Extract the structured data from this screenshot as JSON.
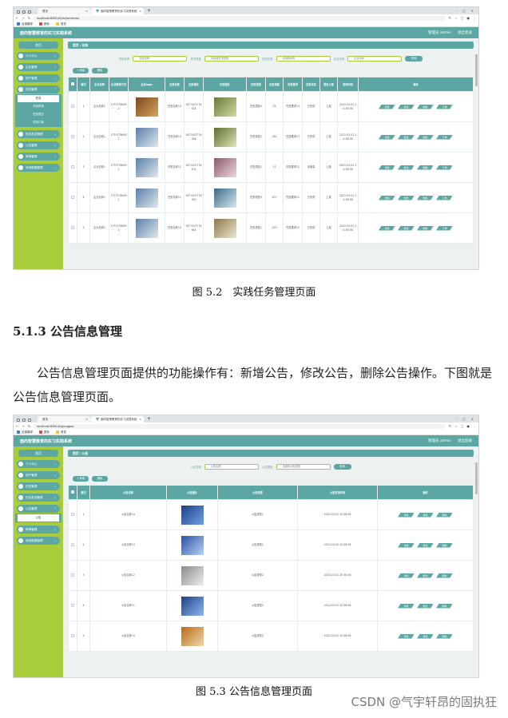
{
  "browser": {
    "tab1": "首页",
    "tab2": "面向智慧教育的实习实践系统",
    "tab_close": "×",
    "new_tab": "+",
    "url1": "localhost:8081/#/shijianrenwu",
    "url2": "localhost:8081/#/gonggao",
    "bookmarks": [
      "百度翻译",
      "图标",
      "首发"
    ],
    "win_min": "–",
    "win_max": "▢",
    "win_close": "×"
  },
  "app": {
    "title": "面向智慧教育的实习实践系统",
    "user": "管理员 admin",
    "logout": "退出登录",
    "home": "首页",
    "menu": [
      "个人中心",
      "企业管理",
      "用户管理",
      "任务管理",
      "任务发送管理",
      "公告管理",
      "简单管理",
      "系统数据管理"
    ],
    "menu2": [
      "个人中心",
      "用户管理",
      "任务管理",
      "任务发送管理",
      "公告管理",
      "简单管理",
      "系统数据管理"
    ],
    "task_sub": [
      "任务",
      "任务申请",
      "任务提交",
      "任务订单"
    ],
    "notice_sub": [
      "公告"
    ],
    "add": "+ 新增",
    "delete": "删除",
    "search": "查询"
  },
  "screen1": {
    "crumb_home": "首页",
    "crumb_page": "任务",
    "filter_labels": [
      "任务名称",
      "任务类型",
      "任务状态",
      "企业名称"
    ],
    "filter_placeholders": [
      "任务名称",
      "请选择任务类型",
      "请选择状态",
      "企业名称"
    ],
    "headers": [
      "",
      "索引",
      "企业名称",
      "企业联系方式",
      "企业logo",
      "任务名称",
      "任务编号",
      "任务图片",
      "任务类型",
      "任务热度",
      "任务要求",
      "任务状态",
      "是否上架",
      "发布时间",
      "操作"
    ],
    "rows": [
      [
        "1",
        "企业名称2",
        "17707786902",
        "任务名称14",
        "1677407730438",
        "任务类型4",
        "25",
        "任务要求14",
        "已完成",
        "上架",
        "2023-03-02 20:38:56"
      ],
      [
        "2",
        "企业名称1",
        "17707786901",
        "任务名称13",
        "1677407730396",
        "任务类型2",
        "252",
        "任务要求13",
        "已完成",
        "上架",
        "2023-03-02 20:38:56"
      ],
      [
        "3",
        "企业名称1",
        "17707786901",
        "任务名称12",
        "1677407730401",
        "任务类型1",
        "12",
        "任务要求12",
        "未接单",
        "上架",
        "2023-03-02 20:38:56"
      ],
      [
        "4",
        "企业名称1",
        "17707786901",
        "任务名称11",
        "1677407730300",
        "任务类型3",
        "407",
        "任务要求11",
        "已完成",
        "上架",
        "2023-03-02 20:38:56"
      ],
      [
        "5",
        "企业名称1",
        "17707786901",
        "任务名称10",
        "1677407730464",
        "任务类型1",
        "420",
        "任务要求10",
        "已完成",
        "上架",
        "2023-03-02 20:38:56"
      ]
    ],
    "actions": [
      "详情",
      "修改",
      "删除",
      "下单"
    ]
  },
  "caption1": "图 5.2　实践任务管理页面",
  "section_title": "5.1.3  公告信息管理",
  "paragraph": "公告信息管理页面提供的功能操作有：新增公告，修改公告，删除公告操作。下图就是公告信息管理页面。",
  "screen2": {
    "crumb_home": "首页",
    "crumb_page": "公告",
    "filter_labels": [
      "公告名称",
      "公告类型"
    ],
    "filter_placeholders": [
      "公告名称",
      "请选择公告类型"
    ],
    "headers": [
      "",
      "索引",
      "公告名称",
      "公告图片",
      "公告类型",
      "公告发布时间",
      "操作"
    ],
    "rows": [
      [
        "1",
        "公告名称14",
        "公告类型1",
        "2023-03-02 20:38:56"
      ],
      [
        "2",
        "公告名称13",
        "公告类型1",
        "2023-03-02 20:38:56"
      ],
      [
        "3",
        "公告名称12",
        "公告类型2",
        "2023-03-02 20:38:56"
      ],
      [
        "4",
        "公告名称11",
        "公告类型2",
        "2023-03-02 20:38:56"
      ],
      [
        "5",
        "公告名称10",
        "公告类型2",
        "2023-03-02 20:38:56"
      ]
    ],
    "actions": [
      "详情",
      "修改",
      "删除"
    ]
  },
  "caption2": "图 5.3  公告信息管理页面",
  "watermark": "CSDN @气宇轩昂的固执狂"
}
